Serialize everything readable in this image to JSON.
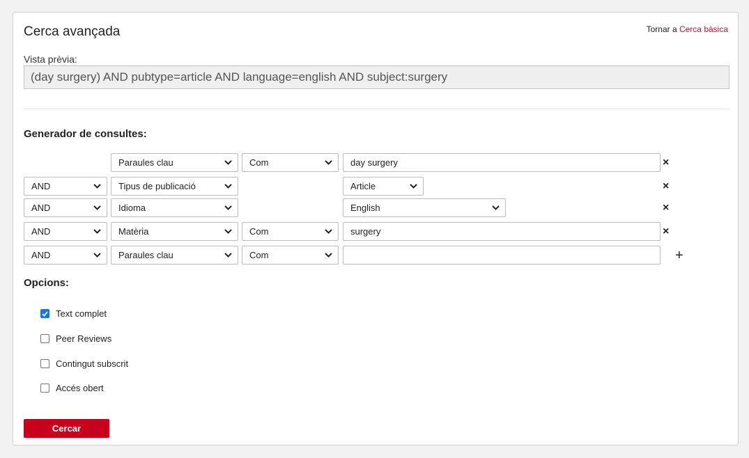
{
  "header": {
    "title": "Cerca avançada",
    "back_prefix": "Tornar a",
    "back_link": "Cerca bàsica"
  },
  "preview": {
    "label": "Vista prèvia:",
    "query": "(day surgery) AND pubtype=article AND language=english AND subject:surgery"
  },
  "builder": {
    "heading": "Generador de consultes:",
    "rows": [
      {
        "bool": "",
        "field": "Paraules clau",
        "mode": "Com",
        "value": "day surgery",
        "value_type": "text"
      },
      {
        "bool": "AND",
        "field": "Tipus de publicació",
        "mode": "",
        "value": "Article",
        "value_type": "select-short"
      },
      {
        "bool": "AND",
        "field": "Idioma",
        "mode": "",
        "value": "English",
        "value_type": "select-long"
      },
      {
        "bool": "AND",
        "field": "Matèria",
        "mode": "Com",
        "value": "surgery",
        "value_type": "text"
      },
      {
        "bool": "AND",
        "field": "Paraules clau",
        "mode": "Com",
        "value": "",
        "value_type": "text"
      }
    ],
    "remove_symbol": "×",
    "add_symbol": "+"
  },
  "options": {
    "heading": "Opcions:",
    "items": [
      {
        "label": "Text complet",
        "checked": true
      },
      {
        "label": "Peer Reviews",
        "checked": false
      },
      {
        "label": "Contingut subscrit",
        "checked": false
      },
      {
        "label": "Accés obert",
        "checked": false
      }
    ]
  },
  "actions": {
    "search_label": "Cercar"
  },
  "colors": {
    "accent": "#c8102e",
    "button": "#c8001e",
    "checkbox": "#1a73e8"
  }
}
